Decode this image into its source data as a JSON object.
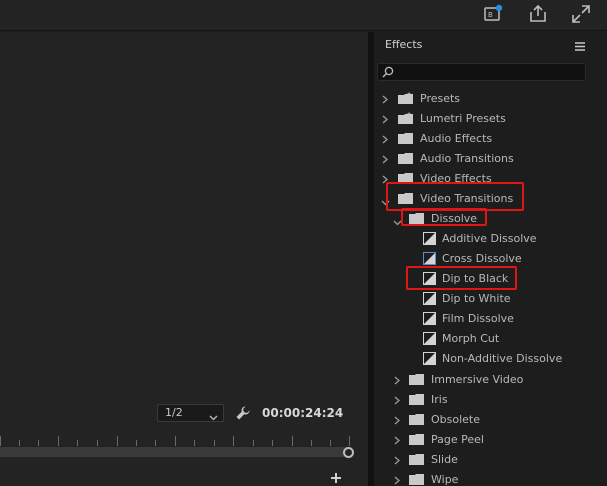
{
  "colors": {
    "background": "#1d1d1d",
    "highlight": "#e01616",
    "text": "#b9b9b9"
  },
  "topbar": {
    "icons": [
      "captions-icon",
      "export-icon",
      "fullscreen-icon"
    ]
  },
  "monitor": {
    "fraction": "1/2",
    "timecode": "00:00:24:24"
  },
  "effects": {
    "title": "Effects",
    "search_placeholder": "",
    "categories": [
      {
        "label": "Presets",
        "icon": "preset-folder-icon",
        "expanded": false
      },
      {
        "label": "Lumetri Presets",
        "icon": "preset-folder-icon",
        "expanded": false
      },
      {
        "label": "Audio Effects",
        "icon": "folder-icon",
        "expanded": false
      },
      {
        "label": "Audio Transitions",
        "icon": "folder-icon",
        "expanded": false
      },
      {
        "label": "Video Effects",
        "icon": "folder-icon",
        "expanded": false
      },
      {
        "label": "Video Transitions",
        "icon": "folder-icon",
        "expanded": true
      }
    ],
    "dissolve_folder": {
      "label": "Dissolve",
      "expanded": true
    },
    "dissolve_items": [
      {
        "label": "Additive Dissolve"
      },
      {
        "label": "Cross Dissolve"
      },
      {
        "label": "Dip to Black"
      },
      {
        "label": "Dip to White"
      },
      {
        "label": "Film Dissolve"
      },
      {
        "label": "Morph Cut"
      },
      {
        "label": "Non-Additive Dissolve"
      }
    ],
    "transition_folders": [
      {
        "label": "Immersive Video"
      },
      {
        "label": "Iris"
      },
      {
        "label": "Obsolete"
      },
      {
        "label": "Page Peel"
      },
      {
        "label": "Slide"
      },
      {
        "label": "Wipe"
      }
    ]
  }
}
